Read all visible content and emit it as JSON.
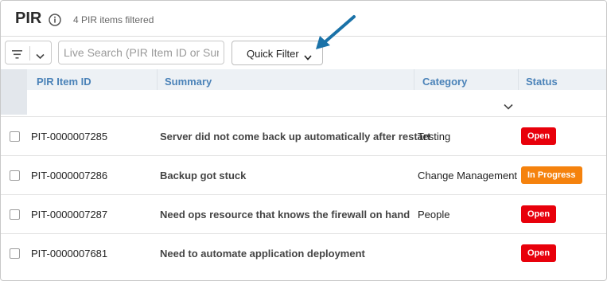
{
  "header": {
    "title": "PIR",
    "info_icon": "info-circle-icon",
    "filtered_text": "4 PIR items filtered"
  },
  "toolbar": {
    "filter_icon": "filter-lines-icon",
    "search_placeholder": "Live Search (PIR Item ID or Summary)",
    "quick_filter_label": "Quick Filter"
  },
  "table": {
    "columns": [
      "PIR Item ID",
      "Summary",
      "Category",
      "Status"
    ],
    "rows": [
      {
        "id": "PIT-0000007285",
        "summary": "Server did not come back up automatically after restart",
        "category": "Testing",
        "status": "Open"
      },
      {
        "id": "PIT-0000007286",
        "summary": "Backup got stuck",
        "category": "Change Management",
        "status": "In Progress"
      },
      {
        "id": "PIT-0000007287",
        "summary": "Need ops resource that knows the firewall on hand",
        "category": "People",
        "status": "Open"
      },
      {
        "id": "PIT-0000007681",
        "summary": "Need to automate application deployment",
        "category": "",
        "status": "Open"
      }
    ]
  },
  "colors": {
    "accent": "#4a82b8",
    "status_open": "#e8000b",
    "status_in_progress": "#f5820d",
    "annotation_arrow": "#1a72a8"
  }
}
